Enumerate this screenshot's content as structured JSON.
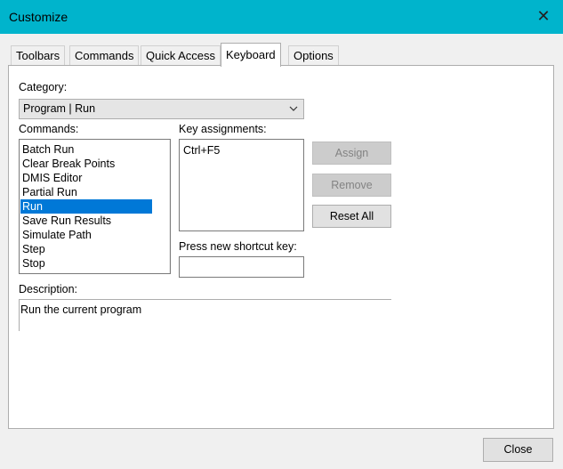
{
  "window": {
    "title": "Customize",
    "close_glyph": "✕"
  },
  "tabs": [
    {
      "label": "Toolbars",
      "active": false
    },
    {
      "label": "Commands",
      "active": false
    },
    {
      "label": "Quick Access",
      "active": false
    },
    {
      "label": "Keyboard",
      "active": true
    },
    {
      "label": "Options",
      "active": false
    }
  ],
  "category": {
    "label": "Category:",
    "value": "Program | Run"
  },
  "commands": {
    "label": "Commands:",
    "items": [
      "Batch Run",
      "Clear Break Points",
      "DMIS Editor",
      "Partial Run",
      "Run",
      "Save Run Results",
      "Simulate Path",
      "Step",
      "Stop"
    ],
    "selected": "Run"
  },
  "key_assignments": {
    "label": "Key assignments:",
    "items": [
      "Ctrl+F5"
    ]
  },
  "shortcut": {
    "label": "Press new shortcut key:",
    "value": ""
  },
  "buttons": {
    "assign": "Assign",
    "remove": "Remove",
    "reset_all": "Reset All",
    "close": "Close"
  },
  "description": {
    "label": "Description:",
    "text": "Run the current program"
  },
  "colors": {
    "titlebar": "#00b4cc",
    "selection": "#0078d7"
  }
}
